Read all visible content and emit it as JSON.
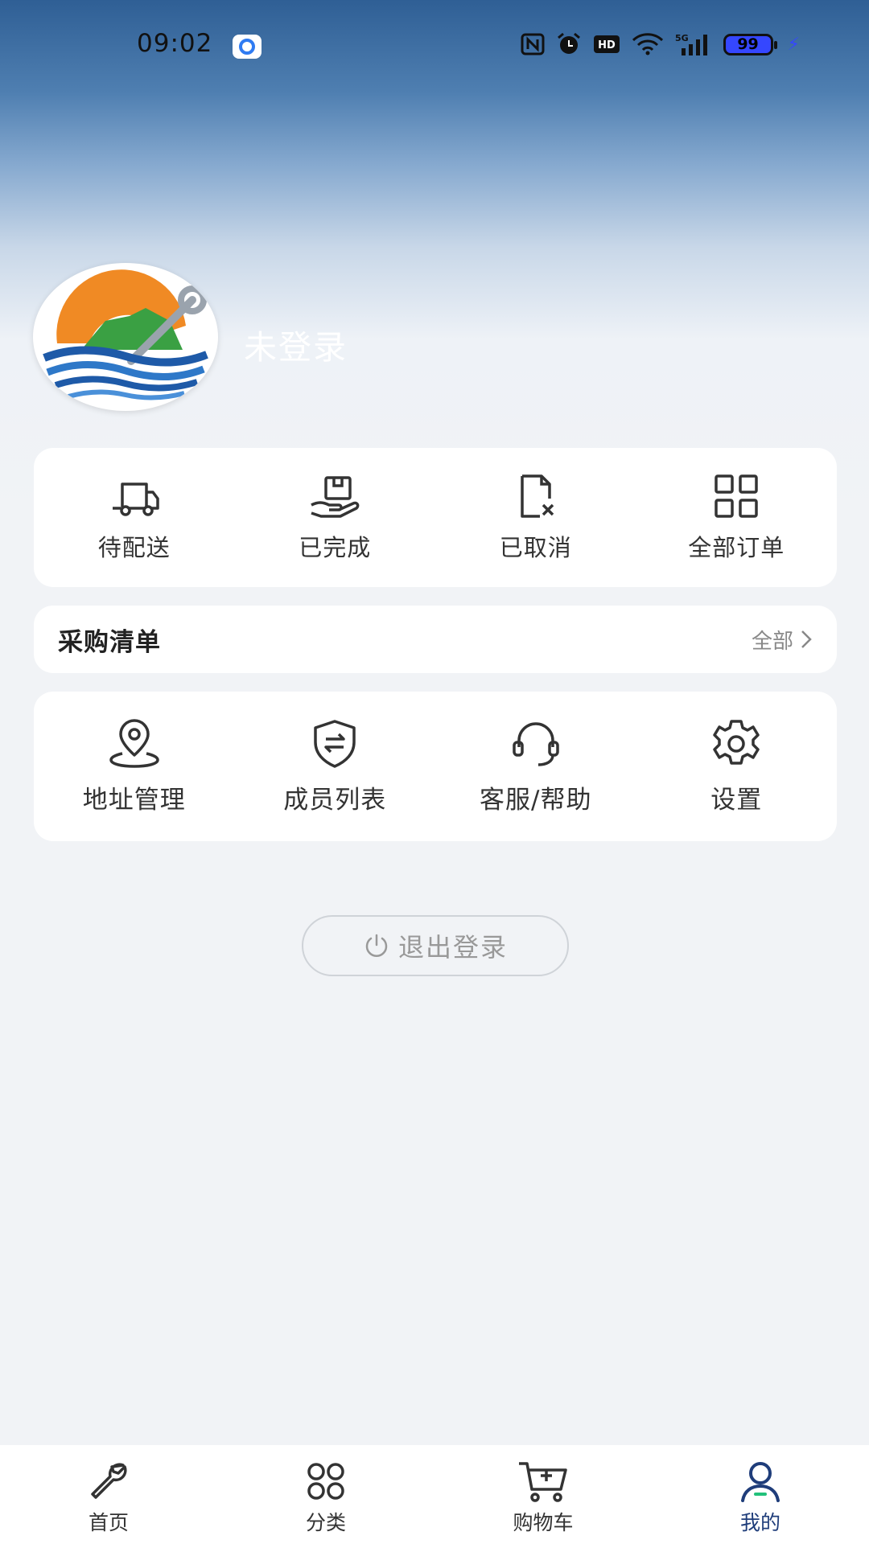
{
  "status_bar": {
    "time": "09:02",
    "icons": [
      "app-notification-icon",
      "nfc-icon",
      "alarm-icon",
      "hd-icon",
      "wifi-icon",
      "5g-signal-icon"
    ],
    "battery": "99"
  },
  "profile": {
    "username": "未登录"
  },
  "orders": {
    "items": [
      {
        "label": "待配送",
        "icon": "truck-icon"
      },
      {
        "label": "已完成",
        "icon": "package-hand-icon"
      },
      {
        "label": "已取消",
        "icon": "cancelled-document-icon"
      },
      {
        "label": "全部订单",
        "icon": "grid-icon"
      }
    ]
  },
  "purchase_list": {
    "title": "采购清单",
    "all_label": "全部"
  },
  "services": {
    "items": [
      {
        "label": "地址管理",
        "icon": "location-icon"
      },
      {
        "label": "成员列表",
        "icon": "shield-transfer-icon"
      },
      {
        "label": "客服/帮助",
        "icon": "headset-icon"
      },
      {
        "label": "设置",
        "icon": "gear-icon"
      }
    ]
  },
  "logout": {
    "label": "退出登录"
  },
  "tabs": [
    {
      "label": "首页",
      "icon": "wrench-icon"
    },
    {
      "label": "分类",
      "icon": "category-icon"
    },
    {
      "label": "购物车",
      "icon": "cart-icon"
    },
    {
      "label": "我的",
      "icon": "user-icon",
      "active": true
    }
  ],
  "colors": {
    "active_tab": "#1f3d7a",
    "header_top": "#2f5f95",
    "background": "#f1f3f6"
  }
}
